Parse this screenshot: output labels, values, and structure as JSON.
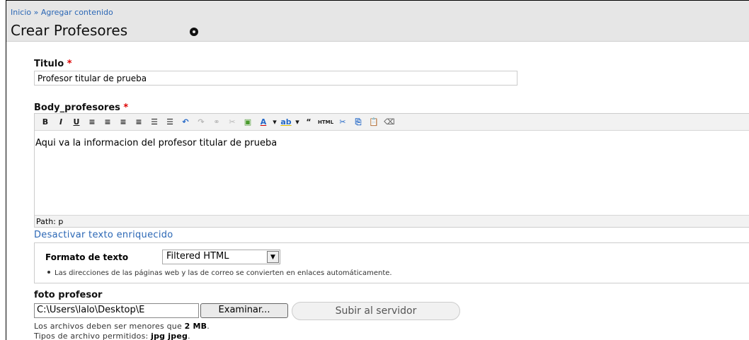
{
  "breadcrumb": {
    "home": "Inicio",
    "separator": "»",
    "current": "Agregar contenido"
  },
  "page": {
    "title": "Crear Profesores",
    "title_icon": "circle-icon"
  },
  "fields": {
    "title": {
      "label": "Titulo",
      "required_mark": "*",
      "value": "Profesor titular de prueba"
    },
    "body": {
      "label": "Body_profesores",
      "required_mark": "*",
      "content": "Aqui va la informacion del profesor titular de prueba",
      "path_label": "Path: p",
      "toolbar": {
        "bold": "B",
        "italic": "I",
        "underline": "U",
        "align_left": "≡",
        "align_center": "≡",
        "align_right": "≡",
        "justify": "≡",
        "bullet_list": "☰",
        "numbered_list": "☰",
        "undo": "↶",
        "redo": "↷",
        "link": "⚭",
        "unlink": "✂",
        "image": "▣",
        "text_color": "A",
        "text_color_dropdown": "▾",
        "highlight": "ab",
        "highlight_dropdown": "▾",
        "blockquote": "“",
        "html": "HTML",
        "cut": "✂",
        "copy": "⎘",
        "paste": "📋",
        "remove_format": "⌫"
      }
    },
    "rich_text_toggle": "Desactivar texto enriquecido",
    "text_format": {
      "label": "Formato de texto",
      "selected": "Filtered HTML",
      "tip": "Las direcciones de las páginas web y las de correo se convierten en enlaces automáticamente."
    },
    "photo": {
      "label": "foto profesor",
      "file_value": "C:\\Users\\lalo\\Desktop\\E",
      "browse_label": "Examinar...",
      "upload_label": "Subir al servidor",
      "size_note_prefix": "Los archivos deben ser menores que",
      "size_note_value": "2 MB",
      "size_note_suffix": ".",
      "types_note_prefix": "Tipos de archivo permitidos:",
      "types_note_value": "jpg jpeg",
      "types_note_suffix": "."
    }
  }
}
